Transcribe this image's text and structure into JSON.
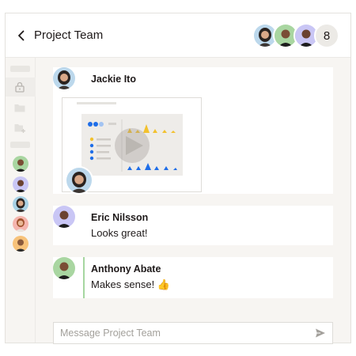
{
  "header": {
    "title": "Project Team",
    "member_count": "8",
    "member_avatars": [
      "avatar-woman-glasses",
      "avatar-man-green",
      "avatar-man-dark"
    ]
  },
  "sidebar": {
    "icons": [
      "lock-icon",
      "folder-icon",
      "folder-add-icon"
    ],
    "people": [
      "green",
      "purple",
      "teal",
      "red",
      "orange"
    ]
  },
  "messages": [
    {
      "author": "Jackie Ito",
      "text": "",
      "attachment": "video-preview"
    },
    {
      "author": "Eric Nilsson",
      "text": "Looks great!"
    },
    {
      "author": "Anthony Abate",
      "text": "Makes sense! 👍"
    }
  ],
  "composer": {
    "placeholder": "Message Project Team"
  },
  "colors": {
    "accent_line": "#a6d6a0",
    "yellow": "#f2c12e",
    "blue": "#1f6ee8"
  }
}
